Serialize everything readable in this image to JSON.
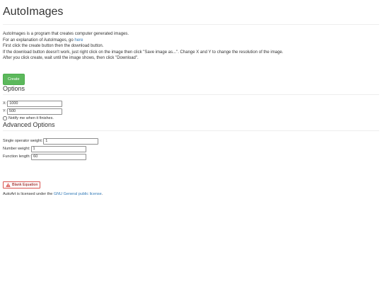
{
  "app": {
    "title": "AutoImages"
  },
  "intro": {
    "line1": "AutoImages is a program that creates computer generated images.",
    "line2_prefix": "For an explanation of AutoImages, go ",
    "line2_link": "here",
    "line3": "First click the create button then the download button.",
    "line4": "If the download button doesn't work, just right click on the image then click \"Save image as...\". Change X and Y to change the resolution of the image.",
    "line5": "After you click create, wait until the image shows, then click \"Download\"."
  },
  "actions": {
    "create_label": "Create"
  },
  "options": {
    "heading": "Options",
    "x_label": "X:",
    "x_value": "1000",
    "y_label": "Y:",
    "y_value": "500",
    "notify_label": "Notify me when it finishes.",
    "notify_checked": false
  },
  "advanced": {
    "heading": "Advanced Options",
    "single_operator_label": "Single operator weight:",
    "single_operator_value": "1",
    "number_weight_label": "Number weight:",
    "number_weight_value": "1",
    "function_length_label": "Function length:",
    "function_length_value": "60"
  },
  "status": {
    "badge_label": "Blank Equation",
    "icon": "warning-icon"
  },
  "footer": {
    "license_prefix": "AutoArt is licensed under the ",
    "license_link": "GNU General public license",
    "license_suffix": "."
  },
  "colors": {
    "accent_link": "#337ab7",
    "create_button": "#5cb85c",
    "danger": "#d9534f"
  }
}
